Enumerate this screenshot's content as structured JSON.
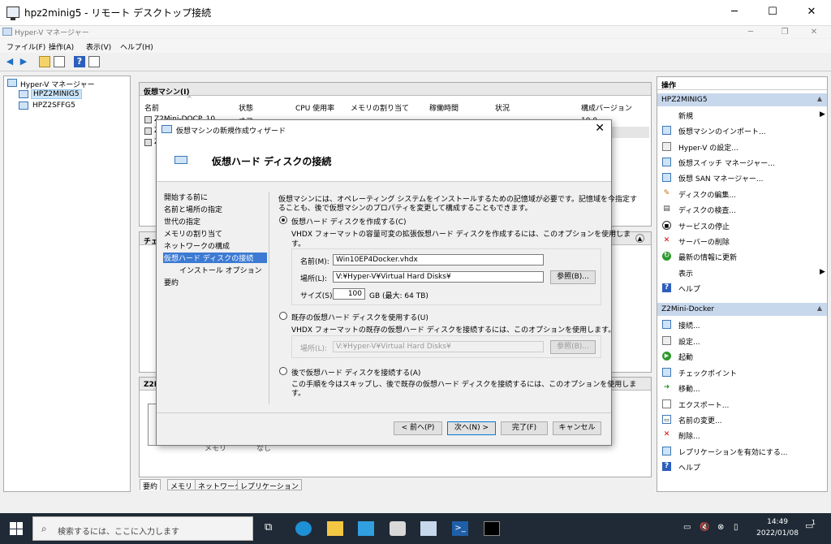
{
  "window": {
    "title": "hpz2minig5 - リモート デスクトップ接続"
  },
  "app": {
    "title": "Hyper-V マネージャー"
  },
  "menu": [
    "ファイル(F)",
    "操作(A)",
    "表示(V)",
    "ヘルプ(H)"
  ],
  "tree": {
    "root": "Hyper-V マネージャー",
    "items": [
      "HPZ2MINIG5",
      "HPZ2SFFG5"
    ]
  },
  "vm_panel": {
    "title": "仮想マシン(I)",
    "columns": [
      "名前",
      "状態",
      "CPU 使用率",
      "メモリの割り当て",
      "稼働時間",
      "状況",
      "構成バージョン"
    ],
    "rows": [
      {
        "name": "Z2Mini-DOCP..10",
        "state": "オフ",
        "version": "10.0"
      },
      {
        "name": "Z",
        "state": "",
        "version": ""
      },
      {
        "name": "Z",
        "state": "",
        "version": ""
      }
    ]
  },
  "checkpoint_panel": {
    "title": "チェ"
  },
  "detail_panel": {
    "title": "Z2M",
    "partial1": "メモリ",
    "partial2": "なし"
  },
  "bottom_tabs": [
    "要約",
    "メモリ",
    "ネットワーク",
    "レプリケーション"
  ],
  "actions": {
    "title": "操作",
    "section1": "HPZ2MINIG5",
    "items1": [
      "新規",
      "仮想マシンのインポート...",
      "Hyper-V の設定...",
      "仮想スイッチ マネージャー...",
      "仮想 SAN マネージャー...",
      "ディスクの編集...",
      "ディスクの検査...",
      "サービスの停止",
      "サーバーの削除",
      "最新の情報に更新",
      "表示",
      "ヘルプ"
    ],
    "section2": "Z2Mini-Docker",
    "items2": [
      "接続...",
      "設定...",
      "起動",
      "チェックポイント",
      "移動...",
      "エクスポート...",
      "名前の変更...",
      "削除...",
      "レプリケーションを有効にする...",
      "ヘルプ"
    ]
  },
  "dialog": {
    "title": "仮想マシンの新規作成ウィザード",
    "heading": "仮想ハード ディスクの接続",
    "steps": [
      "開始する前に",
      "名前と場所の指定",
      "世代の指定",
      "メモリの割り当て",
      "ネットワークの構成",
      "仮想ハード ディスクの接続",
      "インストール オプション",
      "要約"
    ],
    "intro1": "仮想マシンには、オペレーティング システムをインストールするための記憶域が必要です。記憶域を今指定す",
    "intro2": "ることも、後で仮想マシンのプロパティを変更して構成することもできます。",
    "opt1": {
      "label": "仮想ハード ディスクを作成する(C)",
      "desc1": "VHDX フォーマットの容量可変の拡張仮想ハード ディスクを作成するには、このオプションを使用しま",
      "desc2": "す。"
    },
    "name_label": "名前(M):",
    "name_value": "Win10EP4Docker.vhdx",
    "loc_label": "場所(L):",
    "loc_value": "V:¥Hyper-V¥Virtual Hard Disks¥",
    "browse": "参照(B)...",
    "size_label": "サイズ(S):",
    "size_value": "100",
    "size_unit": "GB (最大: 64 TB)",
    "opt2": {
      "label": "既存の仮想ハード ディスクを使用する(U)",
      "desc1": "VHDX フォーマットの既存の仮想ハード ディスクを接続するには、このオプションを使用します。"
    },
    "loc2_label": "場所(L):",
    "loc2_value": "V:¥Hyper-V¥Virtual Hard Disks¥",
    "browse2": "参照(B)...",
    "opt3": {
      "label": "後で仮想ハード ディスクを接続する(A)",
      "desc1": "この手順を今はスキップし、後で既存の仮想ハード ディスクを接続するには、このオプションを使用しま",
      "desc2": "す。"
    },
    "btn_prev": "< 前へ(P)",
    "btn_next": "次へ(N) >",
    "btn_finish": "完了(F)",
    "btn_cancel": "キャンセル"
  },
  "taskbar": {
    "search_placeholder": "検索するには、ここに入力します",
    "time": "14:49",
    "date": "2022/01/08",
    "notif": "1"
  }
}
